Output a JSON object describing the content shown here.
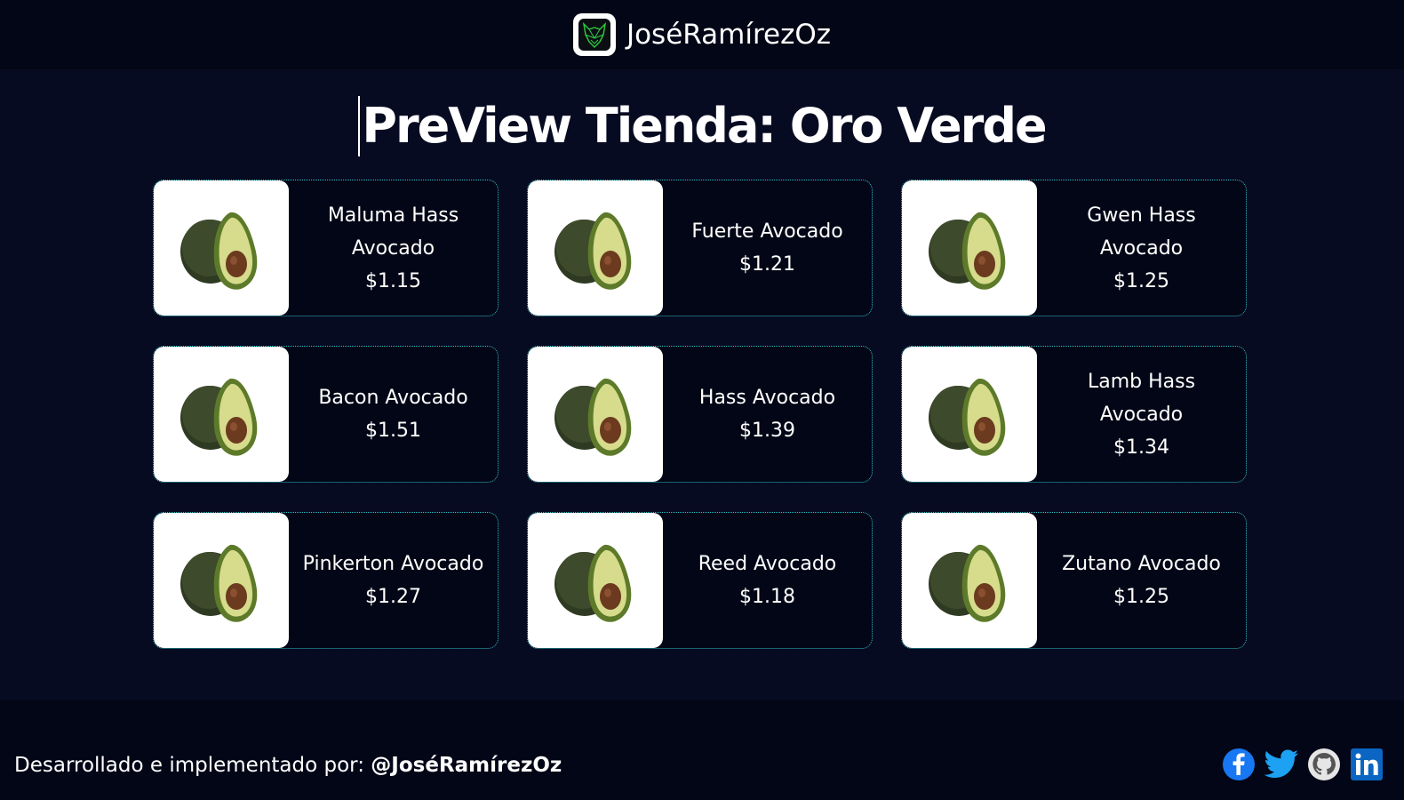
{
  "header": {
    "brand_name": "JoséRamírezOz",
    "logo_icon": "wolf-logo-icon"
  },
  "main": {
    "title": "PreView Tienda: Oro Verde"
  },
  "products": [
    {
      "name": "Maluma Hass Avocado",
      "price": "$1.15"
    },
    {
      "name": "Fuerte Avocado",
      "price": "$1.21"
    },
    {
      "name": "Gwen Hass Avocado",
      "price": "$1.25"
    },
    {
      "name": "Bacon Avocado",
      "price": "$1.51"
    },
    {
      "name": "Hass Avocado",
      "price": "$1.39"
    },
    {
      "name": "Lamb Hass Avocado",
      "price": "$1.34"
    },
    {
      "name": "Pinkerton Avocado",
      "price": "$1.27"
    },
    {
      "name": "Reed Avocado",
      "price": "$1.18"
    },
    {
      "name": "Zutano Avocado",
      "price": "$1.25"
    }
  ],
  "footer": {
    "credit_prefix": "Desarrollado e implementado por: ",
    "credit_handle": "@JoséRamírezOz",
    "socials": [
      "facebook-icon",
      "twitter-icon",
      "github-icon",
      "linkedin-icon"
    ]
  },
  "colors": {
    "background": "#030616",
    "main": "#070b21",
    "card_border": "#2dbfc6",
    "accent": "#2ecc40"
  }
}
